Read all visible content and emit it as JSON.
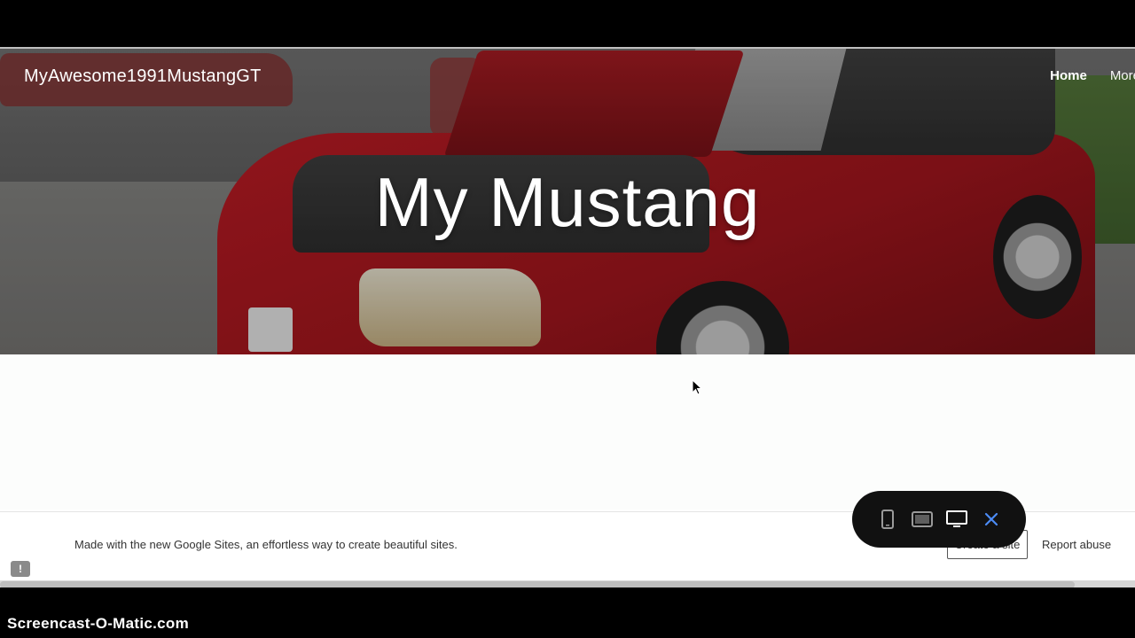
{
  "site": {
    "title": "MyAwesome1991MustangGT",
    "nav": [
      {
        "label": "Home"
      },
      {
        "label": "More"
      }
    ],
    "hero_title": "My Mustang"
  },
  "footer": {
    "made_text": "Made with the new Google Sites, an effortless way to create beautiful sites.",
    "create_label": "Create a site",
    "report_label": "Report abuse",
    "feedback_glyph": "!"
  },
  "preview_bar": {
    "icons": [
      "phone-icon",
      "tablet-icon",
      "desktop-icon",
      "close-icon"
    ],
    "close_glyph": "✕",
    "accent": "#4c8bf5"
  },
  "watermark": "Screencast-O-Matic.com"
}
